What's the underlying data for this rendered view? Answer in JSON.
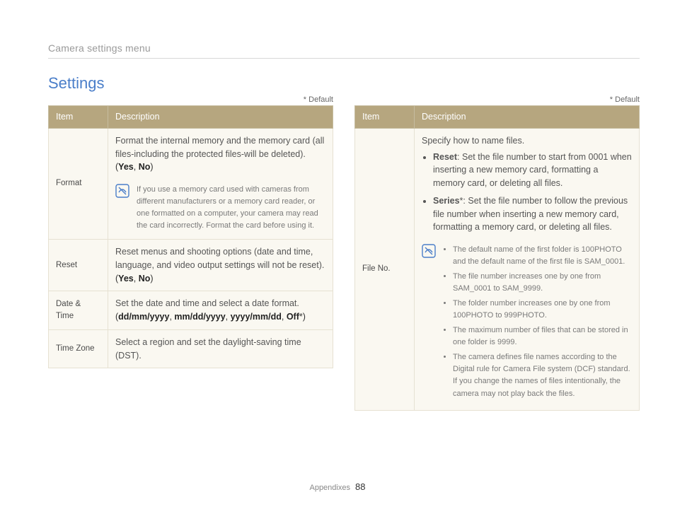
{
  "breadcrumb": "Camera settings menu",
  "title": "Settings",
  "defaultNote": "* Default",
  "headers": {
    "item": "Item",
    "description": "Description"
  },
  "left": {
    "rows": [
      {
        "item": "Format",
        "desc": "Format the internal memory and the memory card (all files-including the protected files-will be deleted).",
        "opts_pre": "(",
        "opt1": "Yes",
        "sep": ", ",
        "opt2": "No",
        "opts_post": ")",
        "note": "If you use a memory card used with cameras from different manufacturers or a memory card reader, or one formatted on a computer, your camera may read the card incorrectly. Format the card before using it."
      },
      {
        "item": "Reset",
        "desc": "Reset menus and shooting options (date and time, language, and video output settings will not be reset).",
        "opts_pre": "(",
        "opt1": "Yes",
        "sep": ", ",
        "opt2": "No",
        "opts_post": ")"
      },
      {
        "item": "Date & Time",
        "desc": "Set the date and time and select a date format.",
        "opts_pre": "(",
        "opt1": "dd/mm/yyyy",
        "sep": ", ",
        "opt2": "mm/dd/yyyy",
        "sep2": ", ",
        "opt3": "yyyy/mm/dd",
        "sep3": ", ",
        "opt4": "Off",
        "star": "*",
        "opts_post": ")"
      },
      {
        "item": "Time Zone",
        "desc": "Select a region and set the daylight-saving time (DST)."
      }
    ]
  },
  "right": {
    "row": {
      "item": "File No.",
      "intro": "Specify how to name files.",
      "bullets": [
        {
          "lead": "Reset",
          "text": ": Set the file number to start from 0001 when inserting a new memory card, formatting a memory card, or deleting all files."
        },
        {
          "lead": "Series",
          "star": "*",
          "text": ": Set the file number to follow the previous file number when inserting a new memory card, formatting a memory card, or deleting all files."
        }
      ],
      "notes": [
        "The default name of the first folder is 100PHOTO and the default name of the first file is SAM_0001.",
        "The file number increases one by one from SAM_0001 to SAM_9999.",
        "The folder number increases one by one from 100PHOTO to 999PHOTO.",
        "The maximum number of files that can be stored in one folder is 9999.",
        "The camera defines file names according to the Digital rule for Camera File system (DCF) standard. If you change the names of files intentionally, the camera may not play back the files."
      ]
    }
  },
  "footer": {
    "section": "Appendixes",
    "page": "88"
  }
}
